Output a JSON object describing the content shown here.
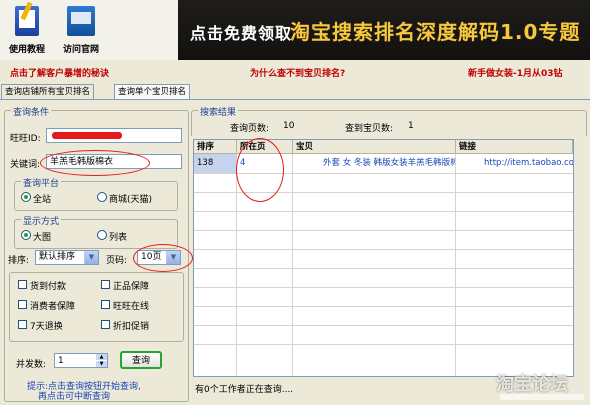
{
  "toolbar": {
    "tutorial_label": "使用教程",
    "site_label": "访问官网",
    "banner_left": "点击免费领取",
    "banner_right": "淘宝搜索排名深度解码1.0专题"
  },
  "promo": {
    "link1": "点击了解客户暴增的秘诀",
    "link2": "为什么查不到宝贝排名?",
    "link3": "新手做女装-1月从03钻"
  },
  "tabs": [
    "查询店铺所有宝贝排名",
    "查询单个宝贝排名"
  ],
  "query": {
    "group_title": "查询条件",
    "wangwang_label": "旺旺ID:",
    "wangwang_value": "",
    "keyword_label": "关键词:",
    "keyword_value": "羊羔毛韩版棉衣",
    "platform_title": "查询平台",
    "platform_options": [
      "全站",
      "商城(天猫)"
    ],
    "display_title": "显示方式",
    "display_options": [
      "大图",
      "列表"
    ],
    "sort_label": "排序:",
    "sort_value": "默认排序",
    "page_label": "页码:",
    "page_value": "10页",
    "filters": [
      "货到付款",
      "正品保障",
      "消费者保障",
      "旺旺在线",
      "7天退换",
      "折扣促销"
    ],
    "concurrency_label": "并发数:",
    "concurrency_value": "1",
    "query_button": "查询",
    "hint_line1": "提示:点击查询按钮开始查询,",
    "hint_line2": "再点击可中断查询"
  },
  "results": {
    "group_title": "搜索结果",
    "pages_label": "查询页数:",
    "pages_value": "10",
    "found_label": "查到宝贝数:",
    "found_value": "1",
    "columns": [
      "排序",
      "所在页",
      "宝贝",
      "链接"
    ],
    "rows": [
      {
        "rank": "138",
        "page": "4",
        "item": "外套 女 冬装 韩版女装羊羔毛韩版棉",
        "link": "http://item.taobao.com/item"
      }
    ]
  },
  "status": {
    "text": "有0个工作者正在查询...."
  },
  "watermark": {
    "text": "淘宝论坛"
  },
  "colors": {
    "accent_red": "#e21b1b",
    "banner_gold": "#f7c83b",
    "group_title": "#1c3f96",
    "link_blue": "#1a44b8"
  }
}
